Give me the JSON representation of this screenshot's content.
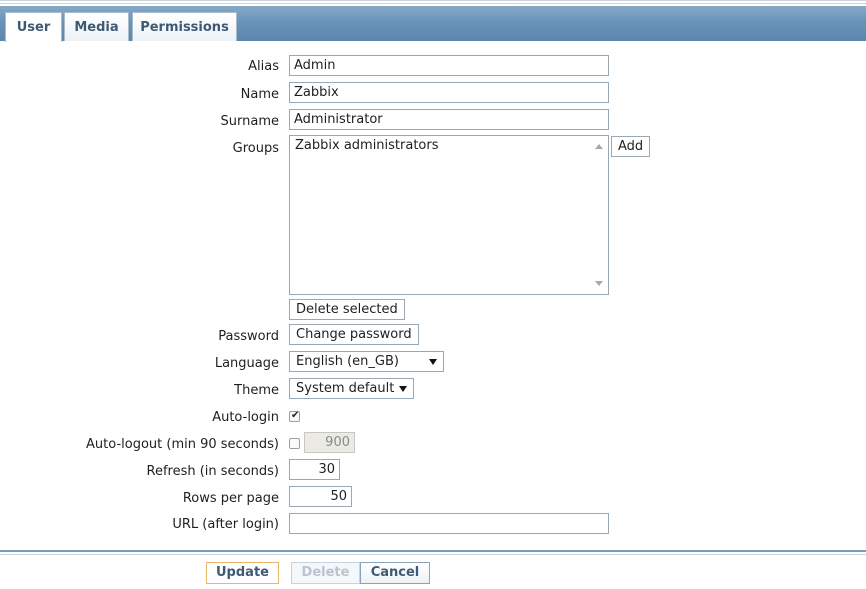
{
  "tabs": [
    {
      "label": "User",
      "active": true
    },
    {
      "label": "Media",
      "active": false
    },
    {
      "label": "Permissions",
      "active": false
    }
  ],
  "form": {
    "alias": {
      "label": "Alias",
      "value": "Admin"
    },
    "name": {
      "label": "Name",
      "value": "Zabbix"
    },
    "surname": {
      "label": "Surname",
      "value": "Administrator"
    },
    "groups": {
      "label": "Groups",
      "items": [
        "Zabbix administrators"
      ],
      "add_label": "Add",
      "delete_label": "Delete selected"
    },
    "password": {
      "label": "Password",
      "button_label": "Change password"
    },
    "language": {
      "label": "Language",
      "value": "English (en_GB)"
    },
    "theme": {
      "label": "Theme",
      "value": "System default"
    },
    "autologin": {
      "label": "Auto-login",
      "checked": true
    },
    "autologout": {
      "label": "Auto-logout (min 90 seconds)",
      "checked": false,
      "value": "900"
    },
    "refresh": {
      "label": "Refresh (in seconds)",
      "value": "30"
    },
    "rows": {
      "label": "Rows per page",
      "value": "50"
    },
    "url": {
      "label": "URL (after login)",
      "value": ""
    }
  },
  "footer": {
    "update_label": "Update",
    "delete_label": "Delete",
    "cancel_label": "Cancel"
  }
}
